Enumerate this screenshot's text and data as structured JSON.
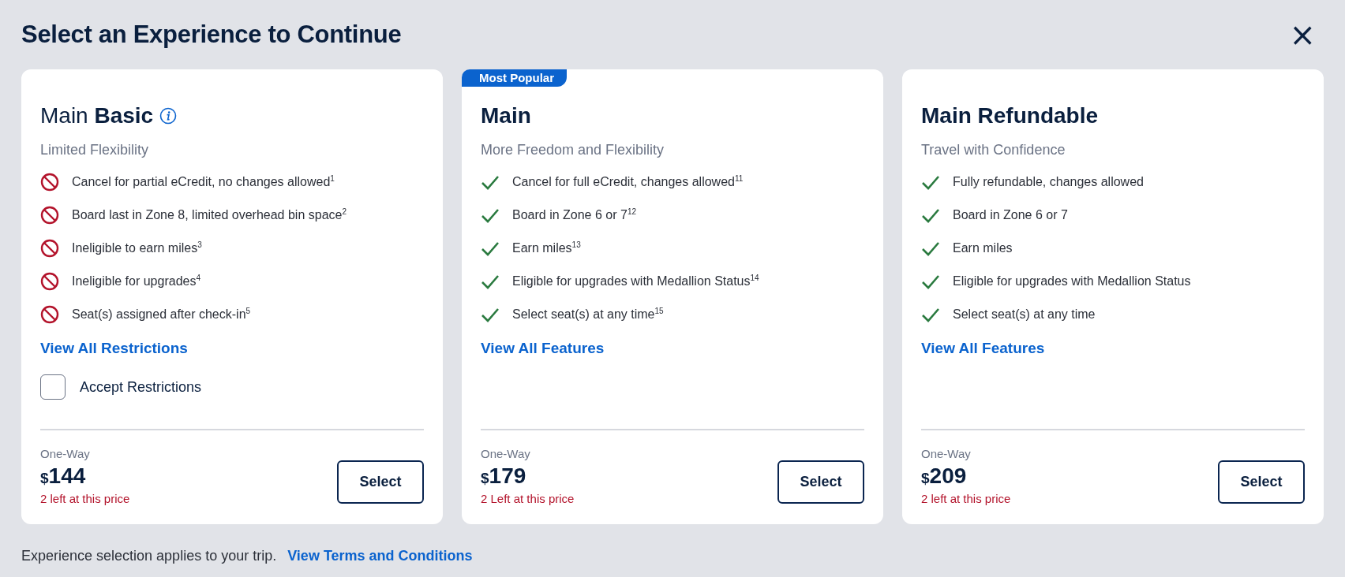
{
  "title": "Select an Experience to Continue",
  "close": "×",
  "cards": [
    {
      "kind": "basic",
      "title": "Main **Basic**",
      "subtitle": "Limited Flexibility",
      "features": [
        {
          "kind": "restriction",
          "text": "Cancel for partial eCredit, no changes allowed$^{1}$"
        },
        {
          "kind": "restriction",
          "text": "Board last in Zone 8, limited overhead bin space$^{2}$"
        },
        {
          "kind": "restriction",
          "text": "Ineligible to earn miles$^{3}$"
        },
        {
          "kind": "restriction",
          "text": "Ineligible for upgrades$^{4}$"
        },
        {
          "kind": "restriction",
          "text": "Seat(s) assigned after check-in$^{5}$"
        }
      ],
      "link": "View All Restrictions",
      "accept": {
        "label": "Accept Restrictions",
        "checked": false
      },
      "trip": "One-Way",
      "currency": "$",
      "amount": "144",
      "availability": "2 left at this price",
      "button": "Select"
    },
    {
      "badge": "Most Popular",
      "kind": "standard",
      "title": "Main",
      "subtitle": "More Freedom and Flexibility",
      "features": [
        {
          "kind": "included",
          "text": "Cancel for full eCredit, changes allowed$^{11}$"
        },
        {
          "kind": "included",
          "text": "Board in Zone 6 or 7$^{12}$"
        },
        {
          "kind": "included",
          "text": "Earn miles$^{13}$"
        },
        {
          "kind": "included",
          "text": "Eligible for upgrades with Medallion Status$^{14}$"
        },
        {
          "kind": "included",
          "text": "Select seat(s) at any time$^{15}$"
        }
      ],
      "link": "View All Features",
      "trip": "One-Way",
      "currency": "$",
      "amount": "179",
      "availability": "2 Left at this price",
      "button": "Select"
    },
    {
      "kind": "standard",
      "title": "Main Refundable",
      "subtitle": "Travel with Confidence",
      "features": [
        {
          "kind": "included",
          "text": "Fully refundable, changes allowed"
        },
        {
          "kind": "included",
          "text": "Board in Zone 6 or 7"
        },
        {
          "kind": "included",
          "text": "Earn miles"
        },
        {
          "kind": "included",
          "text": "Eligible for upgrades with Medallion Status"
        },
        {
          "kind": "included",
          "text": "Select seat(s) at any time"
        }
      ],
      "link": "View All Features",
      "trip": "One-Way",
      "currency": "$",
      "amount": "209",
      "availability": "2 left at this price",
      "button": "Select"
    }
  ],
  "footer": {
    "note": "Experience selection applies to your trip.",
    "link": "View Terms and Conditions"
  }
}
